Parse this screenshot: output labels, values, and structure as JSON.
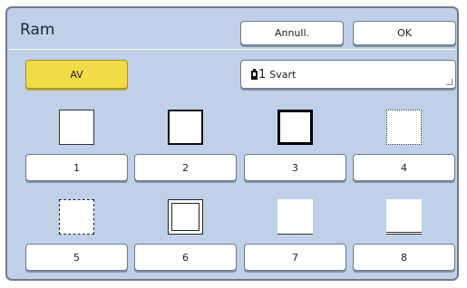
{
  "dialog": {
    "title": "Ram",
    "cancel_label": "Annull.",
    "ok_label": "OK"
  },
  "off_button": {
    "label": "AV",
    "color": "#f1dc48"
  },
  "ink_button": {
    "drum": "1",
    "label": "Svart",
    "icon": "ink-cartridge-icon"
  },
  "frame_options": [
    {
      "label": "1",
      "style": "thin-solid"
    },
    {
      "label": "2",
      "style": "medium-solid"
    },
    {
      "label": "3",
      "style": "thick-solid"
    },
    {
      "label": "4",
      "style": "dotted"
    },
    {
      "label": "5",
      "style": "dashed"
    },
    {
      "label": "6",
      "style": "double"
    },
    {
      "label": "7",
      "style": "bottom-line"
    },
    {
      "label": "8",
      "style": "bottom-double-line"
    }
  ],
  "colors": {
    "panel": "#bfd0e8",
    "border": "#6f7b88"
  }
}
